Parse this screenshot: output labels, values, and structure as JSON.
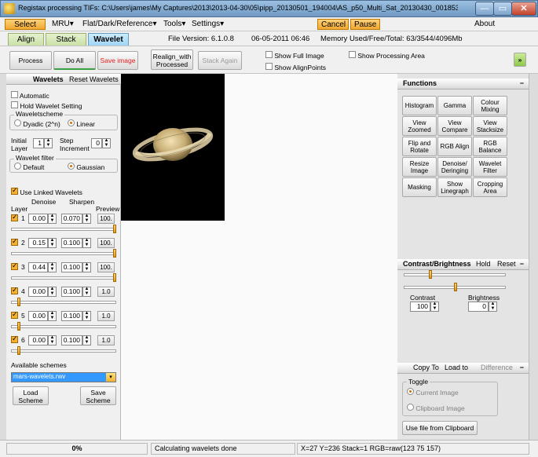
{
  "window": {
    "title": "Registax processing TIFs: C:\\Users\\james\\My Captures\\2013\\2013-04-30\\05\\pipp_20130501_194004\\AS_p50_Multi_Sat_20130430_001853_pipp_...",
    "minimize": "—",
    "maximize": "▭",
    "close": "✕"
  },
  "menu": {
    "select": "Select",
    "mru": "MRU",
    "flat_dark_ref": "Flat/Dark/Reference",
    "tools": "Tools",
    "settings": "Settings",
    "cancel": "Cancel",
    "pause": "Pause",
    "about": "About",
    "dropdown_glyph": "▾"
  },
  "tabs": {
    "align": "Align",
    "stack": "Stack",
    "wavelet": "Wavelet"
  },
  "info": {
    "file_version": "File Version: 6.1.0.8",
    "date": "06-05-2011 06:46",
    "memory": "Memory Used/Free/Total: 63/3544/4096Mb"
  },
  "toolbar": {
    "process": "Process",
    "do_all": "Do All",
    "save_image": "Save image",
    "realign": "Realign_with Processed",
    "stack_again": "Stack Again",
    "show_full_image": "Show Full Image",
    "show_align_points": "Show AlignPoints",
    "show_processing_area": "Show Processing Area",
    "expand": "»"
  },
  "wavelets": {
    "header": "Wavelets",
    "reset": "Reset Wavelets",
    "automatic": "Automatic",
    "hold_setting": "Hold Wavelet Setting",
    "scheme_legend": "Waveletscheme",
    "dyadic": "Dyadic (2^n)",
    "linear": "Linear",
    "initial_layer_label": "Initial Layer",
    "initial_layer": "1",
    "step_increment_label": "Step Increment",
    "step_increment": "0",
    "filter_legend": "Wavelet filter",
    "default": "Default",
    "gaussian": "Gaussian",
    "use_linked": "Use Linked Wavelets",
    "col_denoise": "Denoise",
    "col_sharpen": "Sharpen",
    "col_layer": "Layer",
    "col_preview": "Preview",
    "layers": [
      {
        "n": "1",
        "denoise": "0.00",
        "sharpen": "0.070",
        "preview": "100.",
        "level": 1.0
      },
      {
        "n": "2",
        "denoise": "0.15",
        "sharpen": "0.100",
        "preview": "100.",
        "level": 1.0
      },
      {
        "n": "3",
        "denoise": "0.44",
        "sharpen": "0.100",
        "preview": "100.",
        "level": 1.0
      },
      {
        "n": "4",
        "denoise": "0.00",
        "sharpen": "0.100",
        "preview": "1.0",
        "level": 0.06
      },
      {
        "n": "5",
        "denoise": "0.00",
        "sharpen": "0.100",
        "preview": "1.0",
        "level": 0.06
      },
      {
        "n": "6",
        "denoise": "0.00",
        "sharpen": "0.100",
        "preview": "1.0",
        "level": 0.06
      }
    ],
    "available_schemes": "Available schemes",
    "scheme_value": "mars-wavelets.rwv",
    "load_scheme": "Load Scheme",
    "save_scheme": "Save Scheme"
  },
  "functions": {
    "header": "Functions",
    "collapse": "−",
    "buttons": [
      "Histogram",
      "Gamma",
      "Colour Mixing",
      "View Zoomed",
      "View Compare",
      "View Stacksize",
      "Flip and Rotate",
      "RGB Align",
      "RGB Balance",
      "Resize Image",
      "Denoise/ Deringing",
      "Wavelet Filter",
      "Masking",
      "Show Linegraph",
      "Cropping Area"
    ]
  },
  "contrast": {
    "header": "Contrast/Brightness",
    "hold": "Hold",
    "reset": "Reset",
    "collapse": "−",
    "contrast_label": "Contrast",
    "contrast_value": "100",
    "brightness_label": "Brightness",
    "brightness_value": "0",
    "slider1_level": 0.25,
    "slider2_level": 0.5
  },
  "copyto": {
    "copy_to": "Copy To",
    "load_to": "Load to",
    "difference": "Difference",
    "collapse": "−",
    "toggle_legend": "Toggle",
    "current_image": "Current Image",
    "clipboard_image": "Clipboard Image",
    "use_file": "Use file from Clipboard"
  },
  "status": {
    "progress": "0%",
    "progress_value": 0,
    "message": "Calculating wavelets done",
    "readout": "X=27 Y=236 Stack=1 RGB=raw(123 75 157)"
  },
  "colors": {
    "accent_orange": "#f0a830",
    "tab_active": "#9ed4f4",
    "tab_green": "#c9e0a7"
  }
}
